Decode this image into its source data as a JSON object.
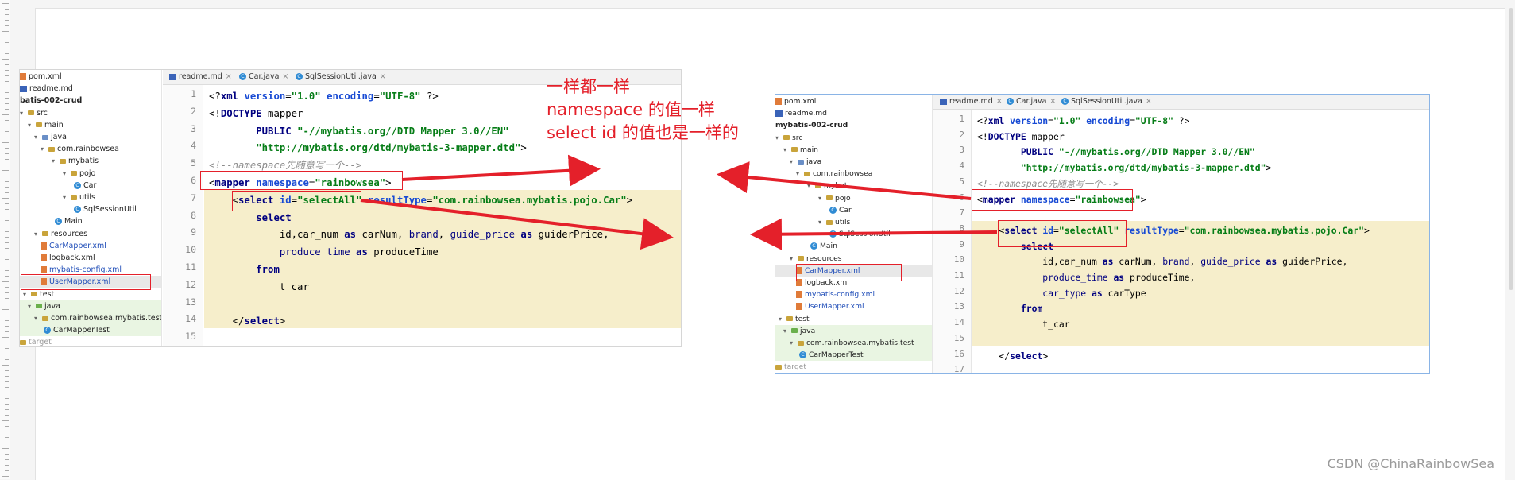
{
  "left": {
    "tabs": [
      "readme.md",
      "Car.java",
      "SqlSessionUtil.java"
    ],
    "tree": [
      {
        "label": "pom.xml",
        "icon": "maven-file-icon"
      },
      {
        "label": "readme.md",
        "icon": "markdown-file-icon"
      },
      {
        "label": "batis-002-crud",
        "icon": "",
        "bold": true
      },
      {
        "label": "src",
        "icon": "folder-icon"
      },
      {
        "label": "main",
        "icon": "folder-icon"
      },
      {
        "label": "java",
        "icon": "source-folder-icon"
      },
      {
        "label": "com.rainbowsea",
        "icon": "package-icon"
      },
      {
        "label": "mybatis",
        "icon": "package-icon"
      },
      {
        "label": "pojo",
        "icon": "package-icon"
      },
      {
        "label": "Car",
        "icon": "class-icon"
      },
      {
        "label": "utils",
        "icon": "package-icon"
      },
      {
        "label": "SqlSessionUtil",
        "icon": "class-icon"
      },
      {
        "label": "Main",
        "icon": "class-icon"
      },
      {
        "label": "resources",
        "icon": "resources-folder-icon"
      },
      {
        "label": "CarMapper.xml",
        "icon": "xml-file-icon"
      },
      {
        "label": "logback.xml",
        "icon": "xml-file-icon"
      },
      {
        "label": "mybatis-config.xml",
        "icon": "xml-file-icon"
      },
      {
        "label": "UserMapper.xml",
        "icon": "xml-file-icon"
      },
      {
        "label": "test",
        "icon": "folder-icon"
      },
      {
        "label": "java",
        "icon": "test-folder-icon"
      },
      {
        "label": "com.rainbowsea.mybatis.test",
        "icon": "package-icon"
      },
      {
        "label": "CarMapperTest",
        "icon": "class-icon"
      },
      {
        "label": "target",
        "icon": "folder-icon"
      }
    ],
    "line_numbers": [
      "1",
      "2",
      "3",
      "4",
      "5",
      "6",
      "7",
      "8",
      "9",
      "10",
      "11",
      "12",
      "13",
      "14",
      "15"
    ],
    "code": [
      "<?xml version=\"1.0\" encoding=\"UTF-8\" ?>",
      "<!DOCTYPE mapper",
      "        PUBLIC \"-//mybatis.org//DTD Mapper 3.0//EN\"",
      "        \"http://mybatis.org/dtd/mybatis-3-mapper.dtd\">",
      "<!--namespace先随意写一个-->",
      "<mapper namespace=\"rainbowsea\">",
      "    <select id=\"selectAll\" resultType=\"com.rainbowsea.mybatis.pojo.Car\">",
      "        select",
      "            id,car_num as carNum, brand, guide_price as guiderPrice,",
      "            produce_time as produceTime",
      "        from",
      "            t_car",
      "",
      "    </select>",
      ""
    ]
  },
  "right": {
    "tabs": [
      "readme.md",
      "Car.java",
      "SqlSessionUtil.java"
    ],
    "tree": [
      {
        "label": "pom.xml",
        "icon": "maven-file-icon"
      },
      {
        "label": "readme.md",
        "icon": "markdown-file-icon"
      },
      {
        "label": "mybatis-002-crud",
        "icon": "",
        "bold": true
      },
      {
        "label": "src",
        "icon": "folder-icon"
      },
      {
        "label": "main",
        "icon": "folder-icon"
      },
      {
        "label": "java",
        "icon": "source-folder-icon"
      },
      {
        "label": "com.rainbowsea",
        "icon": "package-icon"
      },
      {
        "label": "mybat",
        "icon": "package-icon"
      },
      {
        "label": "pojo",
        "icon": "package-icon"
      },
      {
        "label": "Car",
        "icon": "class-icon"
      },
      {
        "label": "utils",
        "icon": "package-icon"
      },
      {
        "label": "SqlSessionUtil",
        "icon": "class-icon"
      },
      {
        "label": "Main",
        "icon": "class-icon"
      },
      {
        "label": "resources",
        "icon": "resources-folder-icon"
      },
      {
        "label": "CarMapper.xml",
        "icon": "xml-file-icon"
      },
      {
        "label": "logback.xml",
        "icon": "xml-file-icon"
      },
      {
        "label": "mybatis-config.xml",
        "icon": "xml-file-icon"
      },
      {
        "label": "UserMapper.xml",
        "icon": "xml-file-icon"
      },
      {
        "label": "test",
        "icon": "folder-icon"
      },
      {
        "label": "java",
        "icon": "test-folder-icon"
      },
      {
        "label": "com.rainbowsea.mybatis.test",
        "icon": "package-icon"
      },
      {
        "label": "CarMapperTest",
        "icon": "class-icon"
      },
      {
        "label": "target",
        "icon": "folder-icon"
      }
    ],
    "line_numbers": [
      "1",
      "2",
      "3",
      "4",
      "5",
      "6",
      "7",
      "8",
      "9",
      "10",
      "11",
      "12",
      "13",
      "14",
      "15",
      "16",
      "17"
    ],
    "code": [
      "<?xml version=\"1.0\" encoding=\"UTF-8\" ?>",
      "<!DOCTYPE mapper",
      "        PUBLIC \"-//mybatis.org//DTD Mapper 3.0//EN\"",
      "        \"http://mybatis.org/dtd/mybatis-3-mapper.dtd\">",
      "<!--namespace先随意写一个-->",
      "<mapper namespace=\"rainbowsea\">",
      "",
      "    <select id=\"selectAll\" resultType=\"com.rainbowsea.mybatis.pojo.Car\">",
      "        select",
      "            id,car_num as carNum, brand, guide_price as guiderPrice,",
      "            produce_time as produceTime,",
      "            car_type as carType",
      "        from",
      "            t_car",
      "",
      "    </select>",
      ""
    ]
  },
  "annotation": {
    "line1": "一样都一样",
    "line2": "namespace 的值一样",
    "line3": "select id 的值也是一样的"
  },
  "watermark": "CSDN @ChinaRainbowSea",
  "colors": {
    "annotation": "#e4202a",
    "highlight_band": "#f6eecb",
    "keyword": "#000080",
    "string": "#067d17"
  }
}
